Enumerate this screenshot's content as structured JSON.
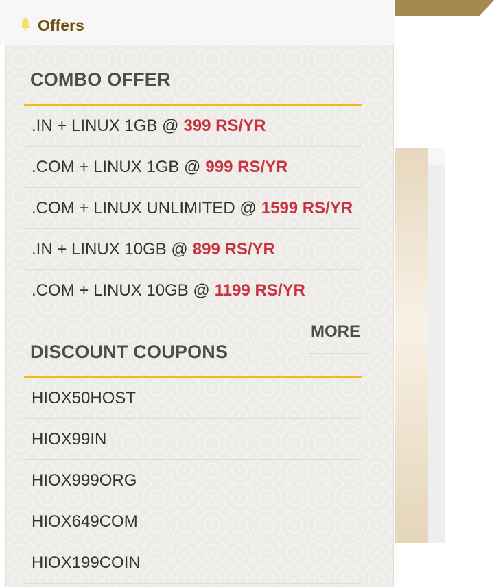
{
  "header": {
    "title": "Offers",
    "icon": "bell-icon",
    "icon_color": "#f7de66",
    "title_color": "#6b4f0a"
  },
  "combo": {
    "heading": "COMBO OFFER",
    "items": [
      {
        "label": ".IN + LINUX 1GB @",
        "price": "399 RS/YR"
      },
      {
        "label": ".COM + LINUX 1GB @",
        "price": "999 RS/YR"
      },
      {
        "label": ".COM + LINUX UNLIMITED @",
        "price": "1599 RS/YR"
      },
      {
        "label": ".IN + LINUX 10GB @",
        "price": "899 RS/YR"
      },
      {
        "label": ".COM + LINUX 10GB @",
        "price": "1199 RS/YR"
      }
    ],
    "more_label": "MORE"
  },
  "coupons": {
    "heading": "DISCOUNT COUPONS",
    "items": [
      {
        "code": "HIOX50HOST"
      },
      {
        "code": "HIOX99IN"
      },
      {
        "code": "HIOX999ORG"
      },
      {
        "code": "HIOX649COM"
      },
      {
        "code": "HIOX199COIN"
      }
    ]
  },
  "colors": {
    "price": "#c9333f",
    "heading_underline": "#f1b91c",
    "heading_text": "#4d4d4d"
  }
}
